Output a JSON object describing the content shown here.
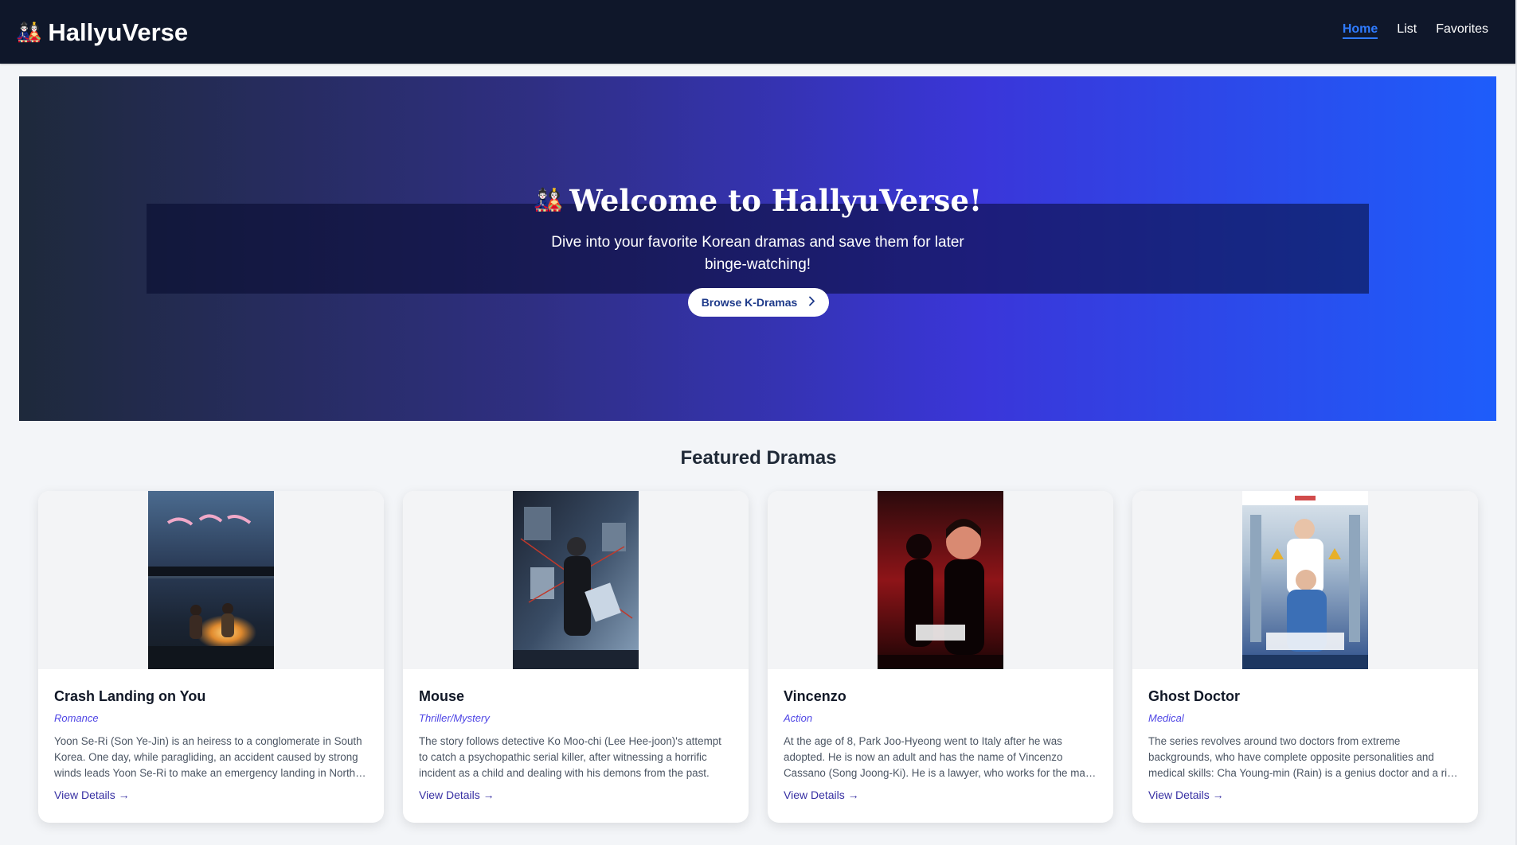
{
  "navbar": {
    "brand_emoji": "🎎",
    "brand_name": "HallyuVerse",
    "links": [
      {
        "label": "Home",
        "active": true
      },
      {
        "label": "List",
        "active": false
      },
      {
        "label": "Favorites",
        "active": false
      }
    ]
  },
  "hero": {
    "title_emoji": "🎎",
    "title": "Welcome to HallyuVerse!",
    "subtitle": "Dive into your favorite Korean dramas and save them for later binge-watching!",
    "button_label": "Browse K-Dramas",
    "button_icon": "chevron-right-icon"
  },
  "featured": {
    "title": "Featured Dramas",
    "cards": [
      {
        "title": "Crash Landing on You",
        "genre": "Romance",
        "description": "Yoon Se-Ri (Son Ye-Jin) is an heiress to a conglomerate in South Korea. One day, while paragliding, an accident caused by strong winds leads Yoon Se-Ri to make an emergency landing in North Korea.",
        "link_label": "View Details →"
      },
      {
        "title": "Mouse",
        "genre": "Thriller/Mystery",
        "description": "The story follows detective Ko Moo-chi (Lee Hee-joon)'s attempt to catch a psychopathic serial killer, after witnessing a horrific incident as a child and dealing with his demons from the past.",
        "link_label": "View Details →"
      },
      {
        "title": "Vincenzo",
        "genre": "Action",
        "description": "At the age of 8, Park Joo-Hyeong went to Italy after he was adopted. He is now an adult and has the name of Vincenzo Cassano (Song Joong-Ki). He is a lawyer, who works for the mafia as a consigliere.",
        "link_label": "View Details →"
      },
      {
        "title": "Ghost Doctor",
        "genre": "Medical",
        "description": "The series revolves around two doctors from extreme backgrounds, who have complete opposite personalities and medical skills: Cha Young-min (Rain) is a genius doctor and a rich man.",
        "link_label": "View Details →"
      }
    ]
  },
  "colors": {
    "navbar_bg": "#0f172a",
    "accent": "#2f7bff",
    "genre": "#4f46e5",
    "link": "#3730a3"
  }
}
